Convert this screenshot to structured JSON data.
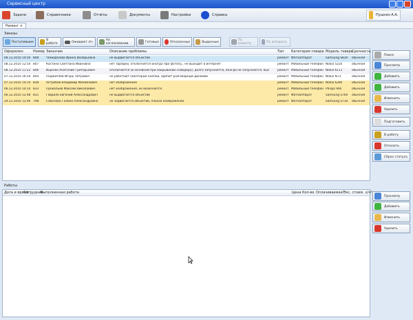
{
  "window": {
    "title": "Сервисный центр"
  },
  "toolbar": {
    "items": [
      {
        "label": "Задачи",
        "icon": "tasks-icon",
        "color": "#d9442b"
      },
      {
        "label": "Справочники",
        "icon": "books-icon",
        "color": "#8a6d5a"
      },
      {
        "label": "Отчёты",
        "icon": "reports-icon",
        "color": "#8d8d8d"
      },
      {
        "label": "Документы",
        "icon": "documents-icon",
        "color": "#b9b9b9"
      },
      {
        "label": "Настройки",
        "icon": "settings-icon",
        "color": "#7a7a7a"
      },
      {
        "label": "Справка",
        "icon": "help-icon",
        "color": "#1c4fd0"
      }
    ],
    "user": "Пушкин А.А."
  },
  "tabs": [
    {
      "label": "Ремонт"
    }
  ],
  "orders": {
    "title": "Заказы",
    "filters": [
      "Поступившие",
      "В работе",
      "Ожидают з/ч",
      "На согласовании",
      "Готовые",
      "Отказанные",
      "Выданные",
      "По клиенту",
      "По аппарату"
    ],
    "columns": [
      "Оформлен",
      "Номер",
      "Заказчик",
      "Описание проблемы",
      "Тип",
      "Категория товара",
      "Модель товара",
      "Срочность"
    ],
    "rows": [
      [
        "08.12.2010 14:56",
        "848",
        "Чемоданова Ирина Валерьевна",
        "не выдвигается объектив",
        "ремонт",
        "Фотоаппарат",
        "Samsung S830",
        "обычная"
      ],
      [
        "08.12.2010 12:54",
        "847",
        "Костина Светлана Ивановна",
        "нет зарядки, отключается иногда при фотогр., не выходит в интернет",
        "ремонт",
        "Мобильный телефон",
        "Nokia 5220",
        "обычная"
      ],
      [
        "08.12.2010 11:22",
        "846",
        "Ищенко Анатолий Григорьевич",
        "отключается (в основном при закрывании слайдера), долго запускается, иногда не запускается, быс",
        "ремонт",
        "Мобильный телефон",
        "Nokia 6111",
        "обычная"
      ],
      [
        "07.12.2010 16:50",
        "844",
        "Поджигаев Игорь Петрович",
        "не работают некоторые кнопки, хрипит разговорный динамик",
        "ремонт",
        "Мобильный телефон",
        "Nokia N73",
        "обычная"
      ],
      [
        "07.12.2010 10:14",
        "838",
        "Ястребов Владимир Михайлович",
        "нет изображения",
        "ремонт",
        "Мобильный телефон",
        "Nokia 6280",
        "обычная"
      ],
      [
        "06.12.2010 14:10",
        "833",
        "Прокопьев Максим Николаевич",
        "нет изображения, не включается",
        "ремонт",
        "Мобильный телефон",
        "Philips 960",
        "обычная"
      ],
      [
        "06.12.2010 12:48",
        "831",
        "Гаврило Евгений Александрович",
        "не выдвигается объектив",
        "ремонт",
        "Фотоаппарат",
        "Samsung S760",
        "обычная"
      ],
      [
        "29.11.2010 12:46",
        "798",
        "Соболева Галина Александровна",
        "не задвигается объектив, плохое изображение",
        "ремонт",
        "Фотоаппарат",
        "Samsung S730",
        "обычная"
      ]
    ]
  },
  "order_actions": [
    "Поиск",
    "Просмотр",
    "Добавить",
    "Добавить",
    "Изменить",
    "Удалить",
    "Подготовить",
    "В работу",
    "Отказать",
    "Сброс статуса"
  ],
  "works": {
    "title": "Работы",
    "columns_left": [
      "Дата и время",
      "Сотрудник",
      "Выполненная работа"
    ],
    "columns_right": [
      "Цена",
      "Кол-во",
      "Оплачиваемая?",
      "Экс. стоим. з/ч?"
    ]
  },
  "work_actions": [
    "Просмотр",
    "Добавить",
    "Изменить",
    "Удалить"
  ],
  "colors": {
    "selected": "#cfe6f5",
    "pending": "#fdeaa8",
    "title": "#2a62d6"
  }
}
